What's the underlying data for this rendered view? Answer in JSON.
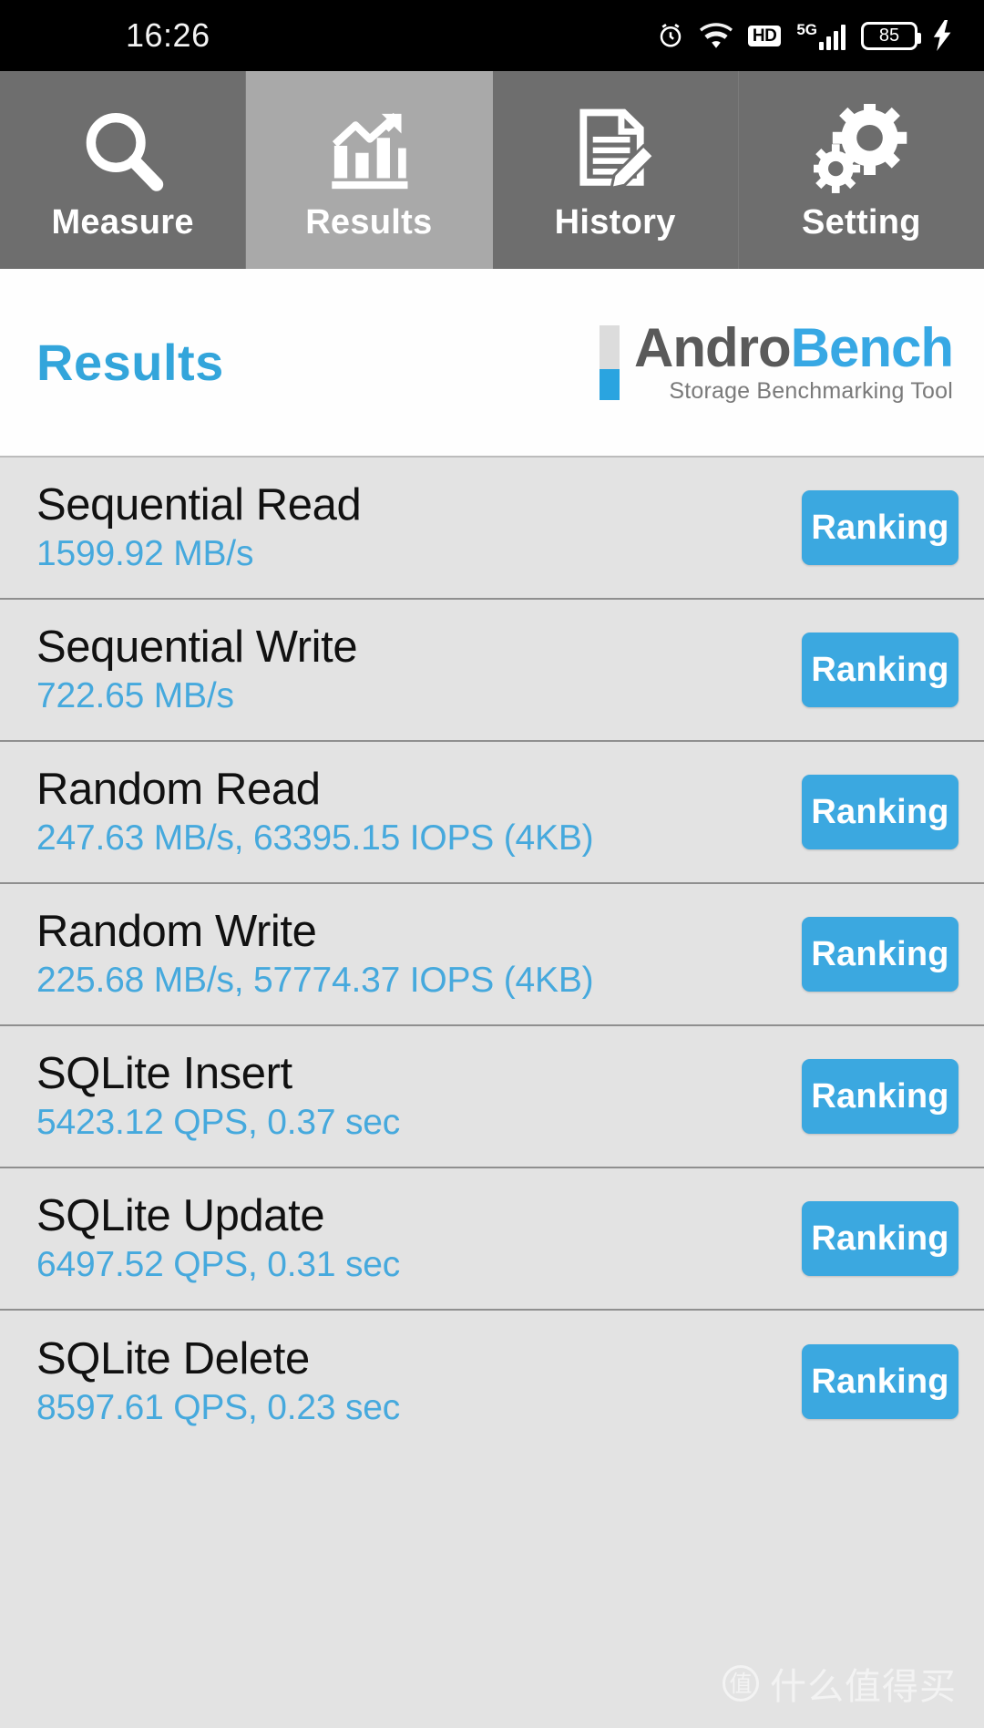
{
  "status_bar": {
    "time": "16:26",
    "battery_percent": "85",
    "network_label": "5G",
    "hd_label": "HD",
    "icons": [
      "alarm-icon",
      "wifi-icon",
      "hd-icon",
      "signal-5g-icon",
      "battery-icon",
      "charging-bolt-icon"
    ]
  },
  "tabs": [
    {
      "label": "Measure",
      "icon": "magnifier-icon",
      "active": false
    },
    {
      "label": "Results",
      "icon": "bar-chart-arrow-icon",
      "active": true
    },
    {
      "label": "History",
      "icon": "document-pencil-icon",
      "active": false
    },
    {
      "label": "Setting",
      "icon": "gears-icon",
      "active": false
    }
  ],
  "header": {
    "page_title": "Results",
    "logo": {
      "word_primary": "Andro",
      "word_secondary": "Bench",
      "subtitle": "Storage Benchmarking Tool"
    }
  },
  "results": [
    {
      "title": "Sequential Read",
      "value": "1599.92 MB/s",
      "button": "Ranking"
    },
    {
      "title": "Sequential Write",
      "value": "722.65 MB/s",
      "button": "Ranking"
    },
    {
      "title": "Random Read",
      "value": "247.63 MB/s, 63395.15 IOPS (4KB)",
      "button": "Ranking"
    },
    {
      "title": "Random Write",
      "value": "225.68 MB/s, 57774.37 IOPS (4KB)",
      "button": "Ranking"
    },
    {
      "title": "SQLite Insert",
      "value": "5423.12 QPS, 0.37 sec",
      "button": "Ranking"
    },
    {
      "title": "SQLite Update",
      "value": "6497.52 QPS, 0.31 sec",
      "button": "Ranking"
    },
    {
      "title": "SQLite Delete",
      "value": "8597.61 QPS, 0.23 sec",
      "button": "Ranking"
    }
  ],
  "watermark": {
    "glyph": "值",
    "text": "什么值得买"
  },
  "colors": {
    "accent_blue": "#3ba8e0",
    "title_blue": "#33a5db",
    "value_blue": "#46a9dd",
    "tab_inactive": "#6e6e6e",
    "tab_active": "#a9a9a9",
    "list_bg": "#e3e3e3"
  }
}
